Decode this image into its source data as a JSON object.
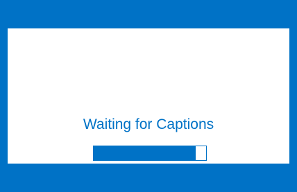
{
  "status": {
    "message": "Waiting for Captions"
  },
  "progress": {
    "fraction": 0.91
  },
  "colors": {
    "accent": "#0072c6",
    "panel": "#ffffff"
  }
}
